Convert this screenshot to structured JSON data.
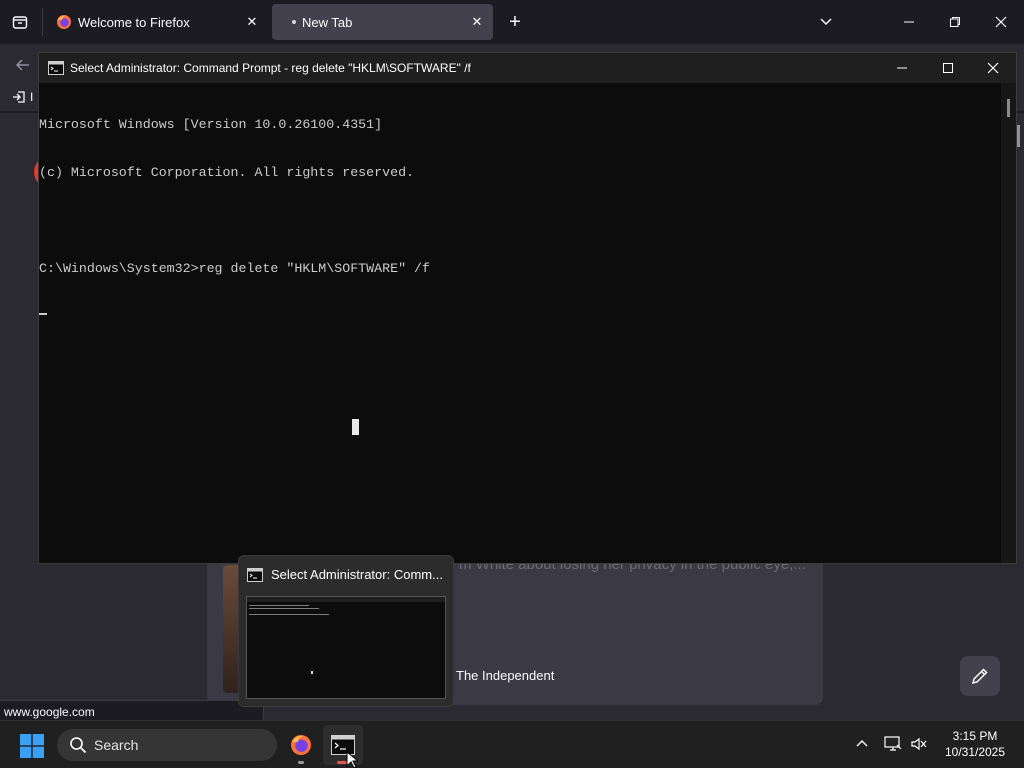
{
  "firefox": {
    "tabs": [
      {
        "label": "Welcome to Firefox",
        "close": "✕"
      },
      {
        "label": "New Tab",
        "close": "✕"
      }
    ],
    "new_tab": "+",
    "bookmarks_toolbar_item": "I",
    "card": {
      "snippet": "m White about losing her privacy in the public eye,...",
      "source": "The Independent"
    },
    "status_url": "www.google.com"
  },
  "cmd": {
    "title": "Select Administrator: Command Prompt - reg  delete \"HKLM\\SOFTWARE\" /f",
    "lines": [
      "Microsoft Windows [Version 10.0.26100.4351]",
      "(c) Microsoft Corporation. All rights reserved.",
      "",
      "C:\\Windows\\System32>reg delete \"HKLM\\SOFTWARE\" /f"
    ]
  },
  "preview": {
    "title": "Select Administrator: Comm..."
  },
  "taskbar": {
    "search_label": "Search",
    "time": "3:15 PM",
    "date": "10/31/2025"
  },
  "colors": {
    "ff_dark": "#1c1b22",
    "ff_toolbar": "#2b2a33",
    "cmd_bg": "#0c0c0c",
    "taskbar": "#202020",
    "cmd_indicator": "#e0564b"
  }
}
